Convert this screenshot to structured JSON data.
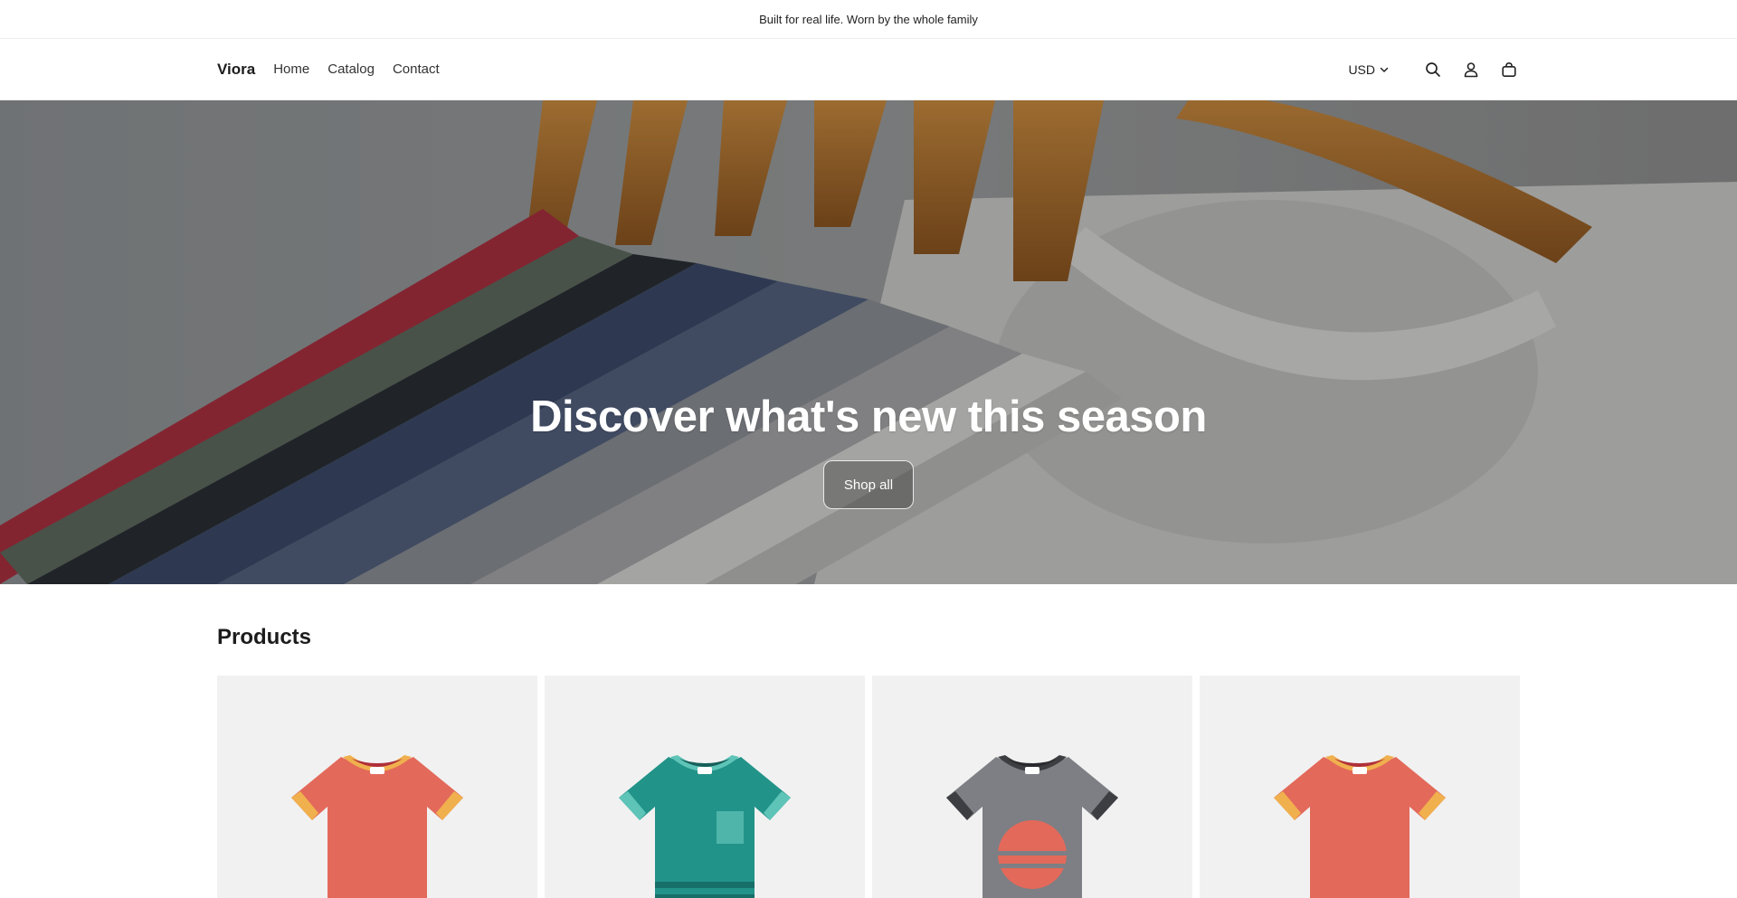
{
  "announcement": {
    "text": "Built for real life. Worn by the whole family"
  },
  "header": {
    "logo": "Viora",
    "nav": [
      {
        "label": "Home"
      },
      {
        "label": "Catalog"
      },
      {
        "label": "Contact"
      }
    ],
    "currency": "USD",
    "icons": [
      "search-icon",
      "account-icon",
      "cart-icon"
    ]
  },
  "hero": {
    "title": "Discover what's new this season",
    "button_label": "Shop all"
  },
  "products": {
    "section_title": "Products",
    "items": [
      {
        "image": "orange-ringer-tshirt",
        "color": "#e3695a"
      },
      {
        "image": "teal-pocket-striped-tshirt",
        "color": "#229389"
      },
      {
        "image": "gray-sunset-graphic-tshirt",
        "color": "#7d7f84"
      },
      {
        "image": "orange-ringer-tshirt",
        "color": "#e3695a"
      }
    ]
  }
}
